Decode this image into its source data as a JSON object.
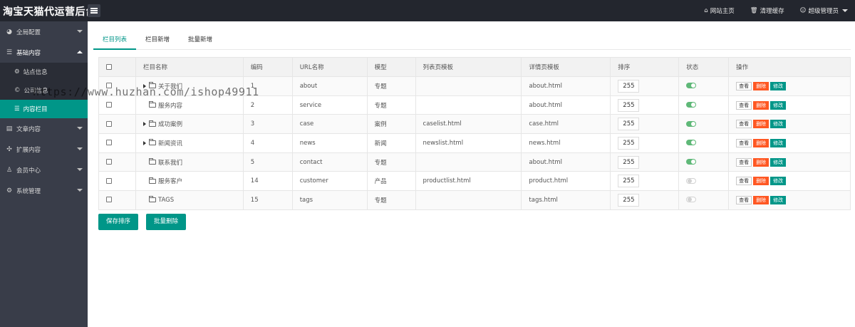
{
  "header": {
    "brand": "淘宝天猫代运营后台",
    "links": [
      {
        "icon": "home-icon",
        "glyph": "⌂",
        "label": "网站主页"
      },
      {
        "icon": "trash-icon",
        "glyph": "🗑",
        "label": "清理缓存"
      },
      {
        "icon": "user-circle-icon",
        "glyph": "☺",
        "label": "超级管理员"
      }
    ]
  },
  "sidebar": {
    "items": [
      {
        "icon": "globe-icon",
        "glyph": "◕",
        "label": "全局配置"
      },
      {
        "icon": "sliders-icon",
        "glyph": "☰",
        "label": "基础内容"
      },
      {
        "icon": "document-icon",
        "glyph": "▤",
        "label": "文章内容"
      },
      {
        "icon": "puzzle-icon",
        "glyph": "✣",
        "label": "扩展内容"
      },
      {
        "icon": "user-icon",
        "glyph": "♙",
        "label": "会员中心"
      },
      {
        "icon": "gear-icon",
        "glyph": "⚙",
        "label": "系统管理"
      }
    ],
    "sub_items": [
      {
        "icon": "gear-icon",
        "glyph": "⚙",
        "label": "站点信息"
      },
      {
        "icon": "copyright-icon",
        "glyph": "©",
        "label": "公司信息"
      },
      {
        "icon": "list-icon",
        "glyph": "☰",
        "label": "内容栏目"
      }
    ]
  },
  "tabs": [
    "栏目列表",
    "栏目新增",
    "批量新增"
  ],
  "table": {
    "headers": [
      "栏目名称",
      "编码",
      "URL名称",
      "模型",
      "列表页模板",
      "详情页模板",
      "排序",
      "状态",
      "操作"
    ],
    "rows": [
      {
        "name": "关于我们",
        "expandable": true,
        "code": "1",
        "url": "about",
        "model": "专题",
        "list_tpl": "",
        "detail_tpl": "about.html",
        "sort": "255",
        "enabled": true
      },
      {
        "name": "服务内容",
        "expandable": false,
        "code": "2",
        "url": "service",
        "model": "专题",
        "list_tpl": "",
        "detail_tpl": "about.html",
        "sort": "255",
        "enabled": true
      },
      {
        "name": "成功案例",
        "expandable": true,
        "code": "3",
        "url": "case",
        "model": "案例",
        "list_tpl": "caselist.html",
        "detail_tpl": "case.html",
        "sort": "255",
        "enabled": true
      },
      {
        "name": "新闻资讯",
        "expandable": true,
        "code": "4",
        "url": "news",
        "model": "新闻",
        "list_tpl": "newslist.html",
        "detail_tpl": "news.html",
        "sort": "255",
        "enabled": true
      },
      {
        "name": "联系我们",
        "expandable": false,
        "code": "5",
        "url": "contact",
        "model": "专题",
        "list_tpl": "",
        "detail_tpl": "about.html",
        "sort": "255",
        "enabled": true
      },
      {
        "name": "服务客户",
        "expandable": false,
        "code": "14",
        "url": "customer",
        "model": "产品",
        "list_tpl": "productlist.html",
        "detail_tpl": "product.html",
        "sort": "255",
        "enabled": false
      },
      {
        "name": "TAGS",
        "expandable": false,
        "code": "15",
        "url": "tags",
        "model": "专题",
        "list_tpl": "",
        "detail_tpl": "tags.html",
        "sort": "255",
        "enabled": false
      }
    ],
    "actions": {
      "view": "查看",
      "delete": "删除",
      "edit": "修改"
    }
  },
  "buttons": {
    "save_sort": "保存排序",
    "batch_delete": "批量删除"
  },
  "watermark": "https://www.huzhan.com/ishop49911",
  "colors": {
    "accent": "#009688",
    "danger": "#ff5722",
    "switch_on": "#5fb878",
    "sidebar": "#393d49",
    "header": "#23262e"
  }
}
